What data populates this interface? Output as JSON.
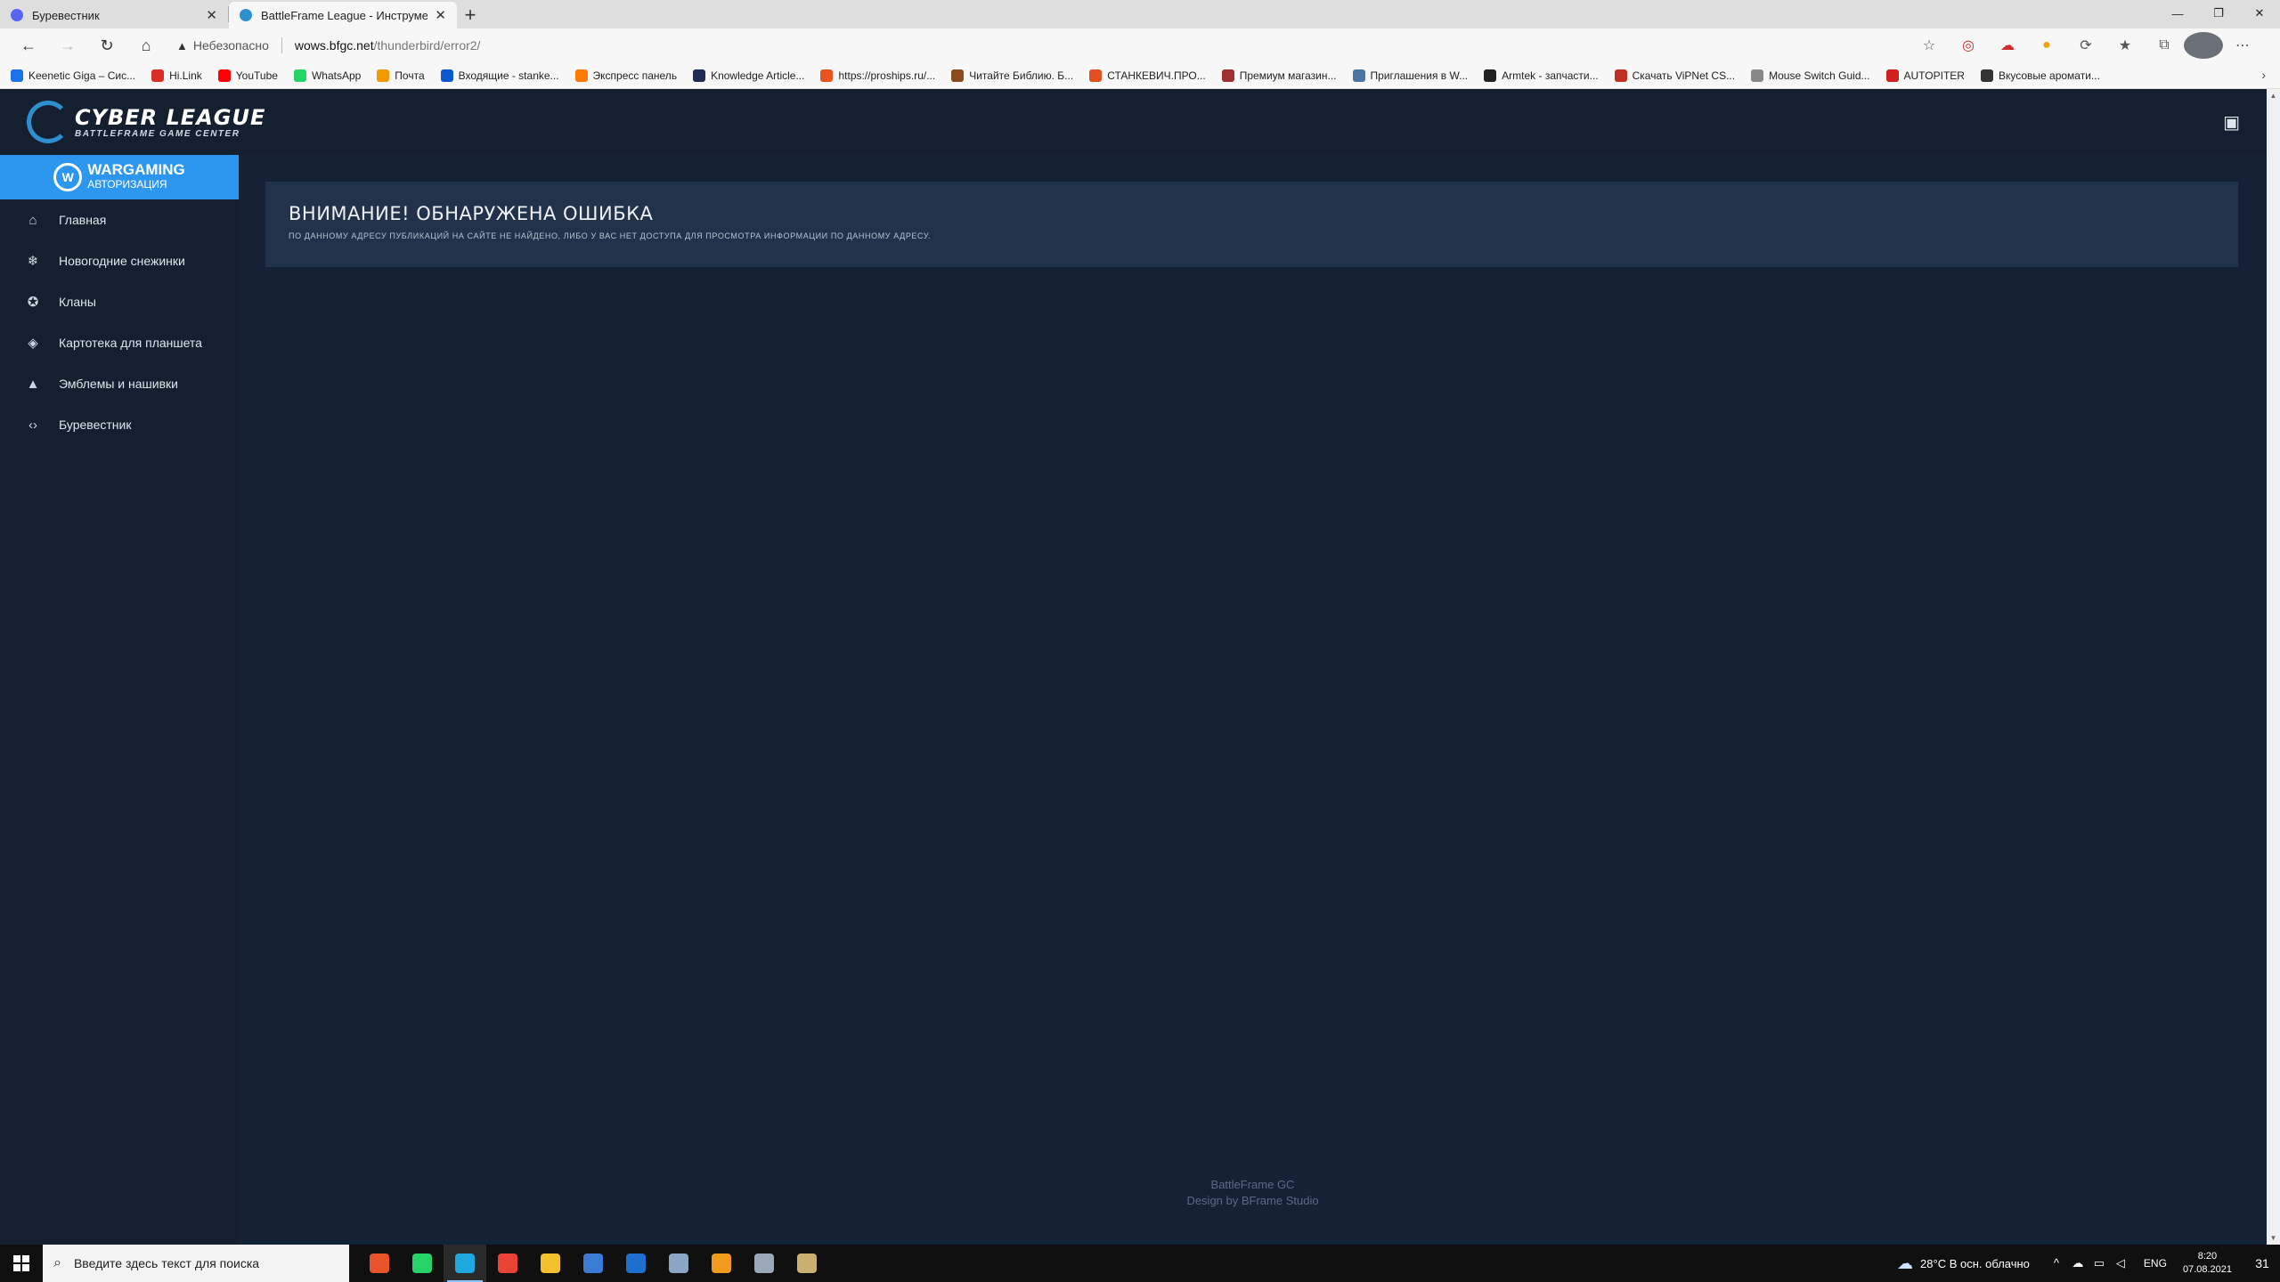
{
  "browser": {
    "tabs": [
      {
        "title": "Буревестник",
        "active": false
      },
      {
        "title": "BattleFrame League - Инструме",
        "active": true
      }
    ],
    "new_tab": "+",
    "url": {
      "security": "Небезопасно",
      "host": "wows.bfgc.net",
      "path": "/thunderbird/error2/"
    },
    "bookmarks": [
      {
        "label": "Keenetic Giga – Сис...",
        "color": "#1a73e8"
      },
      {
        "label": "Hi.Link",
        "color": "#d93025"
      },
      {
        "label": "YouTube",
        "color": "#ff0000"
      },
      {
        "label": "WhatsApp",
        "color": "#25d366"
      },
      {
        "label": "Почта",
        "color": "#f29900"
      },
      {
        "label": "Входящие - stanke...",
        "color": "#0b57d0"
      },
      {
        "label": "Экспресс панель",
        "color": "#ff7a00"
      },
      {
        "label": "Knowledge Article...",
        "color": "#1f2a55"
      },
      {
        "label": "https://proships.ru/...",
        "color": "#e8531e"
      },
      {
        "label": "Читайте Библию. Б...",
        "color": "#8b4b1e"
      },
      {
        "label": "СТАНКЕВИЧ.ПРО...",
        "color": "#e05020"
      },
      {
        "label": "Премиум магазин...",
        "color": "#a03030"
      },
      {
        "label": "Приглашения в W...",
        "color": "#4c75a3"
      },
      {
        "label": "Armtek - запчасти...",
        "color": "#222222"
      },
      {
        "label": "Скачать ViPNet CS...",
        "color": "#c03020"
      },
      {
        "label": "Mouse Switch Guid...",
        "color": "#888888"
      },
      {
        "label": "AUTOPITER",
        "color": "#d02020"
      },
      {
        "label": "Вкусовые аромати...",
        "color": "#333333"
      }
    ]
  },
  "site": {
    "logo": {
      "title": "CYBER LEAGUE",
      "subtitle": "BATTLEFRAME GAME CENTER"
    },
    "auth": {
      "title": "WARGAMING",
      "subtitle": "АВТОРИЗАЦИЯ"
    },
    "nav": [
      {
        "label": "Главная",
        "icon": "home-icon",
        "glyph": "⌂"
      },
      {
        "label": "Новогодние снежинки",
        "icon": "snowflake-icon",
        "glyph": "❄"
      },
      {
        "label": "Кланы",
        "icon": "clan-icon",
        "glyph": "✪"
      },
      {
        "label": "Картотека для планшета",
        "icon": "layers-icon",
        "glyph": "◈"
      },
      {
        "label": "Эмблемы и нашивки",
        "icon": "emblem-icon",
        "glyph": "▲"
      },
      {
        "label": "Буревестник",
        "icon": "code-icon",
        "glyph": "‹›"
      }
    ],
    "error": {
      "title": "ВНИМАНИЕ! ОБНАРУЖЕНА ОШИБКА",
      "message": "По данному адресу публикаций на сайте не найдено, либо у вас нет доступа для просмотра информации по данному адресу."
    },
    "footer": {
      "line1": "BattleFrame GC",
      "line2": "Design by BFrame Studio"
    }
  },
  "taskbar": {
    "search_placeholder": "Введите здесь текст для поиска",
    "weather": "28°C  В осн. облачно",
    "language": "ENG",
    "time": "8:20",
    "date": "07.08.2021",
    "notification_count": "31",
    "apps": [
      {
        "name": "ccleaner-icon",
        "color": "#e8532a"
      },
      {
        "name": "whatsapp-icon",
        "color": "#25d366"
      },
      {
        "name": "edge-icon",
        "color": "#1fa8e0"
      },
      {
        "name": "chrome-icon",
        "color": "#ea4335"
      },
      {
        "name": "explorer-icon",
        "color": "#f3c02e"
      },
      {
        "name": "store-icon",
        "color": "#3a7bd5"
      },
      {
        "name": "mail-icon",
        "color": "#1e6fd0"
      },
      {
        "name": "wows-icon",
        "color": "#8aa6c2"
      },
      {
        "name": "wgc-icon",
        "color": "#f09a1e"
      },
      {
        "name": "ship-icon",
        "color": "#9aa8b8"
      },
      {
        "name": "wows-launcher-icon",
        "color": "#c9b070"
      }
    ]
  }
}
